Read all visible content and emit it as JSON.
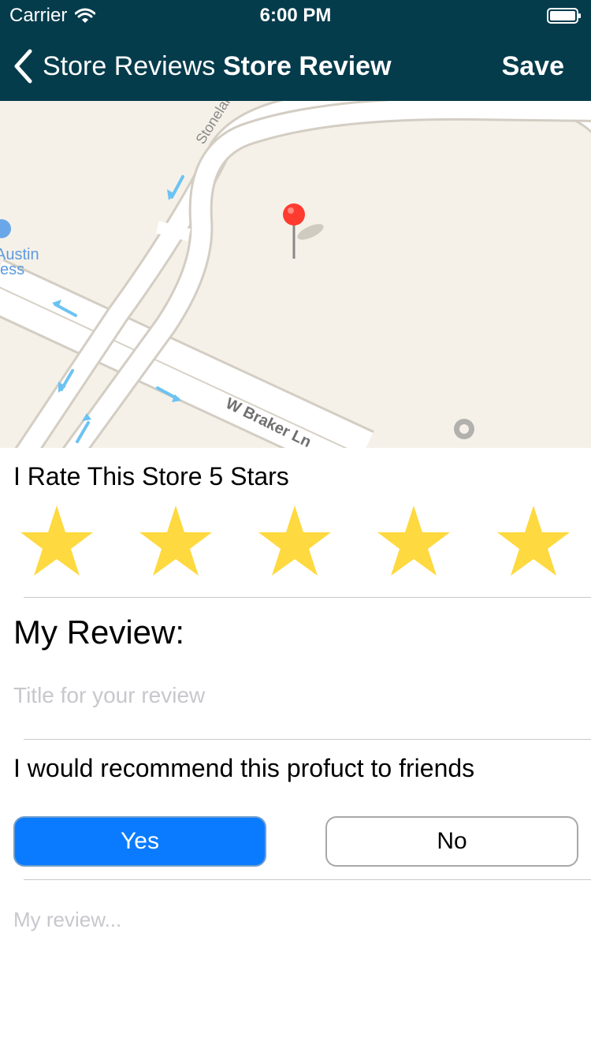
{
  "status_bar": {
    "carrier": "Carrier",
    "time": "6:00 PM",
    "wifi_icon": "wifi-icon",
    "battery_icon": "battery-icon"
  },
  "nav": {
    "back_label": "Store Reviews",
    "back_icon": "chevron-left-icon",
    "title": "Store Review",
    "save_label": "Save"
  },
  "map": {
    "street_labels": [
      "Stonelake",
      "W Braker Ln"
    ],
    "poi_label_lines": [
      "Austin",
      "ess"
    ],
    "pin_color": "#ff3b30"
  },
  "rating": {
    "label": "I Rate This Store 5 Stars",
    "value": 5,
    "max": 5,
    "star_color": "#fed93f"
  },
  "review": {
    "section_title": "My Review:",
    "title_placeholder": "Title for your review",
    "title_value": "",
    "body_placeholder": "My review...",
    "body_value": ""
  },
  "recommend": {
    "label": "I would recommend this profuct to friends",
    "yes_label": "Yes",
    "no_label": "No",
    "selected": "Yes"
  },
  "colors": {
    "header": "#053c4c",
    "selected_button": "#0a7bff",
    "map_background": "#f6f1e8"
  }
}
